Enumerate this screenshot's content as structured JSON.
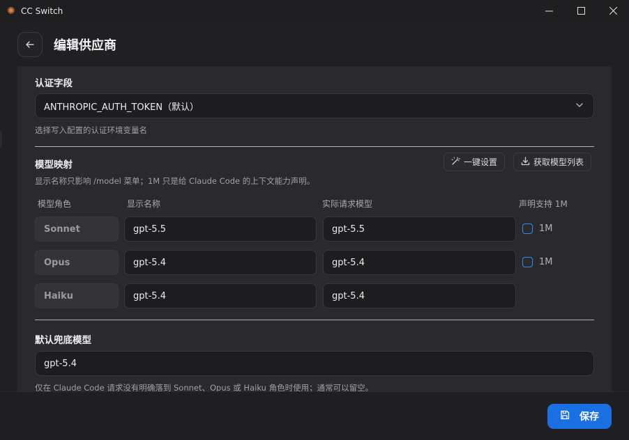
{
  "window": {
    "title": "CC Switch",
    "icon": "sun-burst-icon"
  },
  "header": {
    "title": "编辑供应商"
  },
  "auth": {
    "label": "认证字段",
    "selected": "ANTHROPIC_AUTH_TOKEN（默认）",
    "hint": "选择写入配置的认证环境变量名"
  },
  "mapping": {
    "label": "模型映射",
    "hint": "显示名称只影响 /model 菜单；1M 只是给 Claude Code 的上下文能力声明。",
    "one_click_label": "一键设置",
    "fetch_label": "获取模型列表",
    "columns": {
      "role": "模型角色",
      "display": "显示名称",
      "actual": "实际请求模型",
      "support1m": "声明支持 1M"
    },
    "rows": [
      {
        "role": "Sonnet",
        "display": "gpt-5.5",
        "actual": "gpt-5.5",
        "checkbox_label": "1M",
        "checked": false
      },
      {
        "role": "Opus",
        "display": "gpt-5.4",
        "actual": "gpt-5.4",
        "checkbox_label": "1M",
        "checked": false
      },
      {
        "role": "Haiku",
        "display": "gpt-5.4",
        "actual": "gpt-5.4"
      }
    ]
  },
  "fallback": {
    "label": "默认兜底模型",
    "value": "gpt-5.4",
    "hint": "仅在 Claude Code 请求没有明确落到 Sonnet、Opus 或 Haiku 角色时使用；通常可以留空。"
  },
  "footer": {
    "save_label": "保存"
  },
  "colors": {
    "accent": "#1a6fe3",
    "background": "#202022",
    "panel": "#2a2a2d",
    "input": "#1d1d20"
  }
}
